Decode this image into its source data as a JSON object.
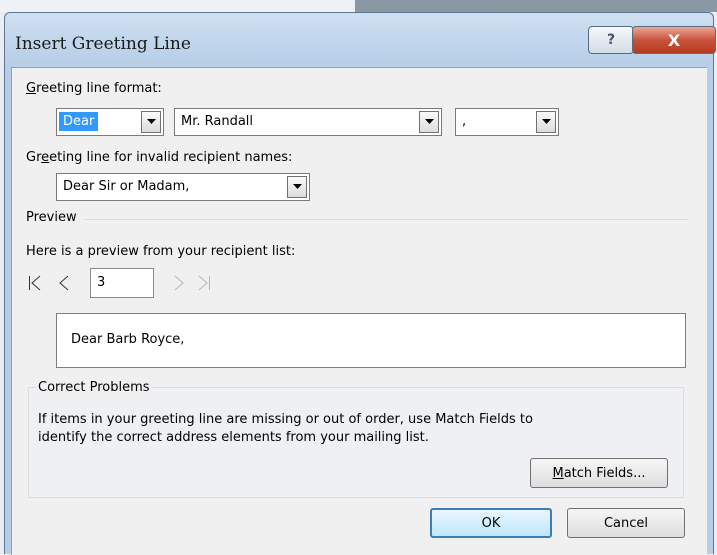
{
  "window": {
    "title": "Insert Greeting Line",
    "help_label": "?",
    "close_label": "X"
  },
  "greeting_format": {
    "label_prefix": "",
    "label_accel": "G",
    "label_rest": "reeting line format:",
    "salutation": "Dear",
    "name_format": "Mr. Randall",
    "punctuation": ","
  },
  "invalid": {
    "label_pre": "Gr",
    "label_accel": "e",
    "label_rest": "eting line for invalid recipient names:",
    "value": "Dear Sir or Madam,"
  },
  "preview": {
    "section_label": "Preview",
    "intro": "Here is a preview from your recipient list:",
    "record_number": "3",
    "text": "Dear Barb Royce,"
  },
  "correct": {
    "group_label": "Correct Problems",
    "line1": "If items in your greeting line are missing or out of order, use Match Fields to",
    "line2": "identify the correct address elements from your mailing list.",
    "match_accel": "M",
    "match_rest": "atch Fields..."
  },
  "buttons": {
    "ok": "OK",
    "cancel": "Cancel"
  },
  "colors": {
    "selection": "#3399ff",
    "close_button": "#c9533a"
  }
}
